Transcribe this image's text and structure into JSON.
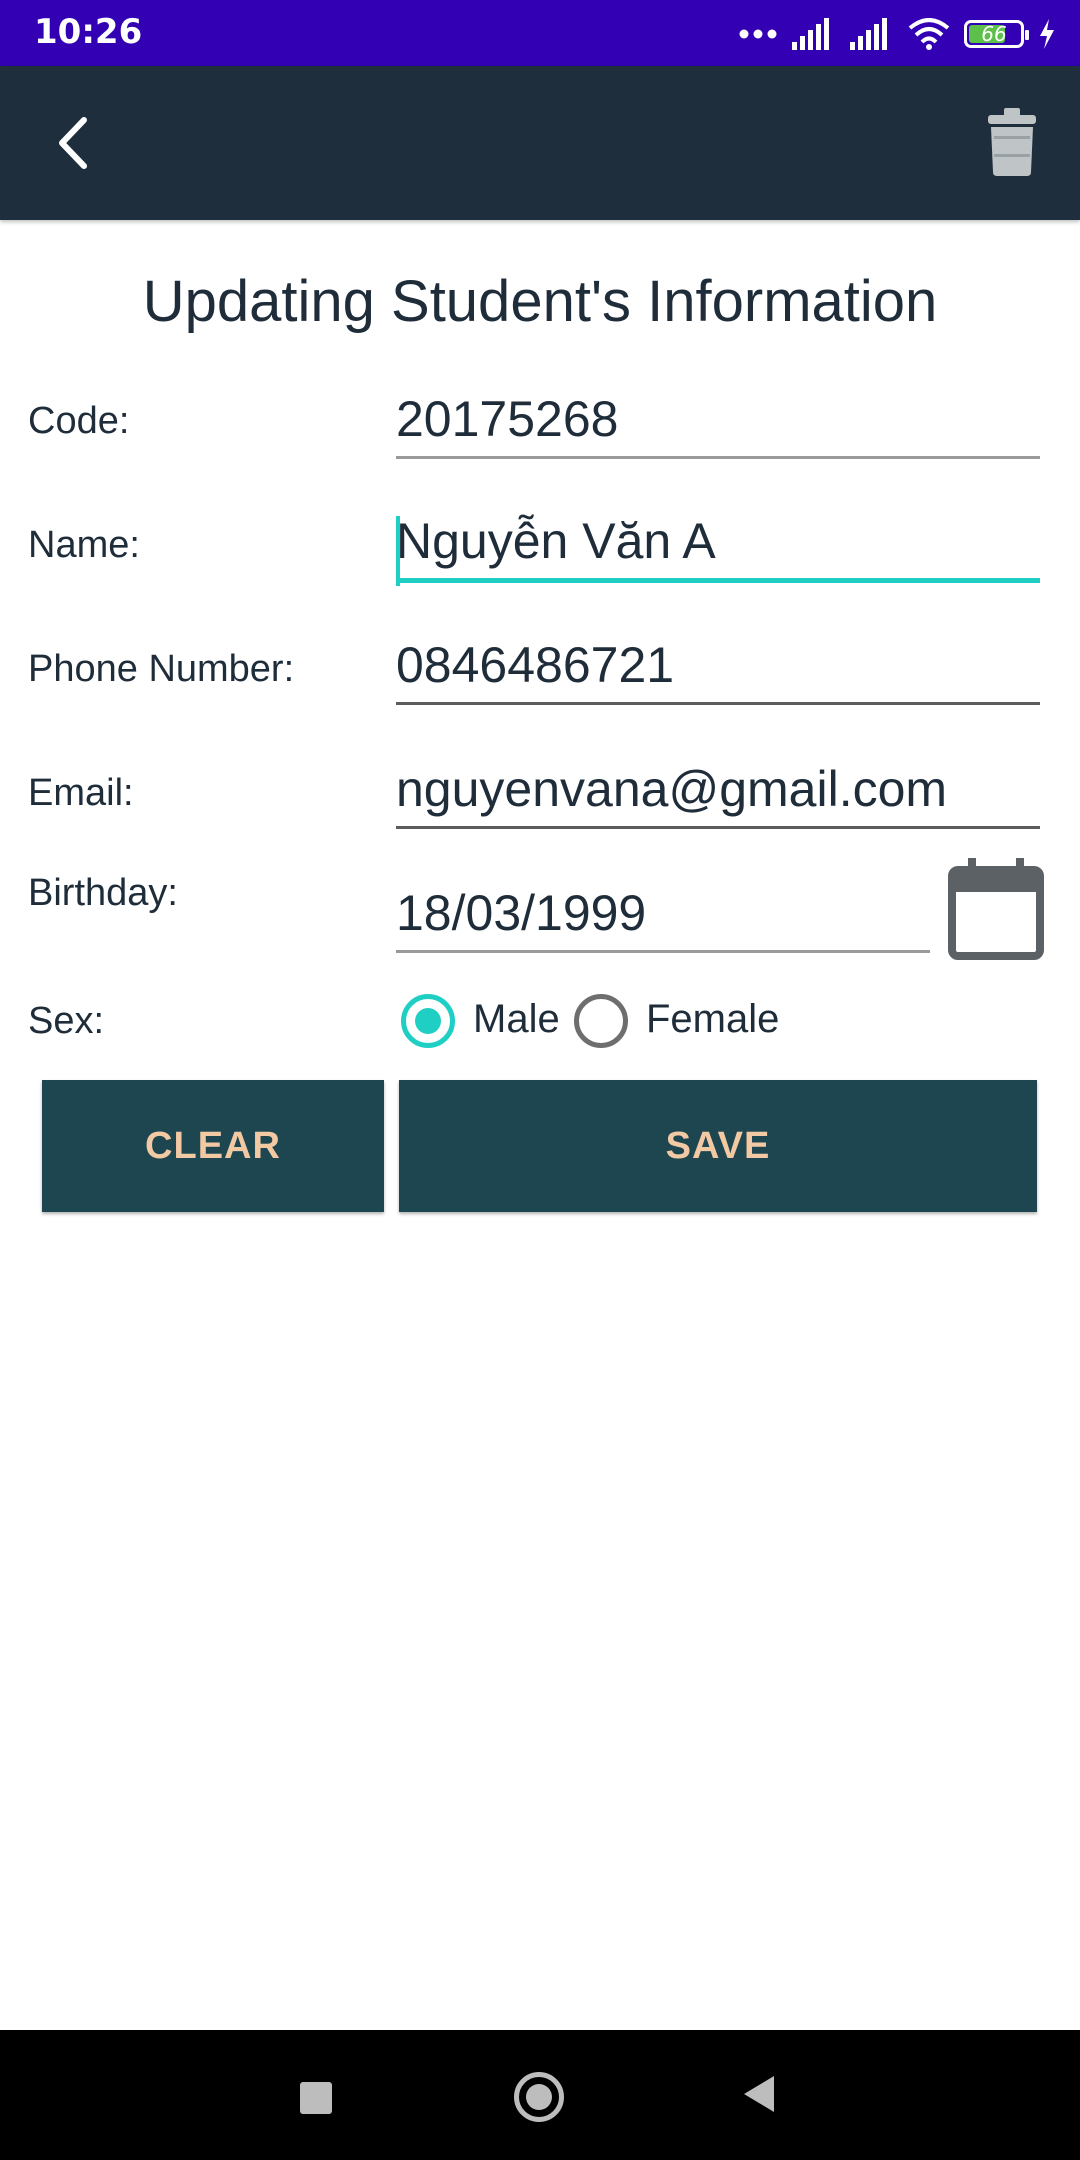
{
  "status_bar": {
    "time": "10:26",
    "battery_level": "66",
    "icons": [
      "dots-icon",
      "signal-icon",
      "signal-icon",
      "wifi-icon",
      "battery-icon",
      "charging-icon"
    ]
  },
  "app_bar": {
    "back_icon": "back-chevron-icon",
    "delete_icon": "trash-icon",
    "background": "#1f2e3d"
  },
  "form": {
    "title": "Updating Student's Information",
    "code": {
      "label": "Code:",
      "value": "20175268"
    },
    "name": {
      "label": "Name:",
      "value": "Nguyễn Văn A"
    },
    "phone": {
      "label": "Phone Number:",
      "value": "0846486721"
    },
    "email": {
      "label": "Email:",
      "value": "nguyenvana@gmail.com"
    },
    "birthday": {
      "label": "Birthday:",
      "value": "18/03/1999"
    },
    "sex": {
      "label": "Sex:",
      "options": [
        "Male",
        "Female"
      ],
      "selected": "Male"
    },
    "accent": "#1fcfc3"
  },
  "buttons": {
    "clear": "CLEAR",
    "save": "SAVE",
    "background": "#1d4650",
    "text_color": "#f3c9a3"
  },
  "nav_bar": {
    "icons": [
      "recents-square-icon",
      "home-circle-icon",
      "back-triangle-icon"
    ]
  }
}
